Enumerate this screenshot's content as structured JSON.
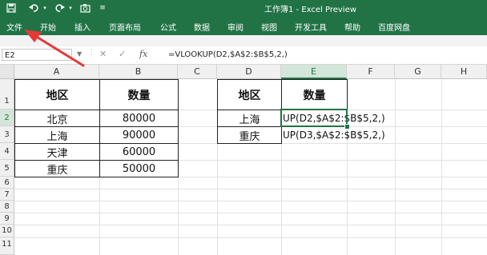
{
  "window": {
    "title": "工作簿1 - Excel Preview"
  },
  "menu": [
    "文件",
    "开始",
    "插入",
    "页面布局",
    "公式",
    "数据",
    "审阅",
    "视图",
    "开发工具",
    "帮助",
    "百度网盘"
  ],
  "formula_bar": {
    "name_box": "E2",
    "fx": "fx",
    "formula": "=VLOOKUP(D2,$A$2:$B$5,2,)"
  },
  "columns": [
    "A",
    "B",
    "C",
    "D",
    "E",
    "F",
    "G",
    "H"
  ],
  "rows": [
    "1",
    "2",
    "3",
    "4",
    "5",
    "6",
    "7",
    "8",
    "9",
    "10",
    "11"
  ],
  "table1": {
    "header": [
      "地区",
      "数量"
    ],
    "rows": [
      [
        "北京",
        "80000"
      ],
      [
        "上海",
        "90000"
      ],
      [
        "天津",
        "60000"
      ],
      [
        "重庆",
        "50000"
      ]
    ]
  },
  "table2": {
    "header": [
      "地区",
      "数量"
    ],
    "rows": [
      [
        "上海",
        "UP(D2,$A$2:$B$5,2,)"
      ],
      [
        "重庆",
        "UP(D3,$A$2:$B$5,2,)"
      ]
    ]
  },
  "colors": {
    "excel_green": "#217346",
    "arrow_red": "#e53935"
  },
  "icons": [
    "save-icon",
    "undo-icon",
    "redo-icon",
    "camera-icon",
    "quick-access-dropdown-icon",
    "cancel-icon",
    "enter-icon",
    "insert-function-icon"
  ]
}
